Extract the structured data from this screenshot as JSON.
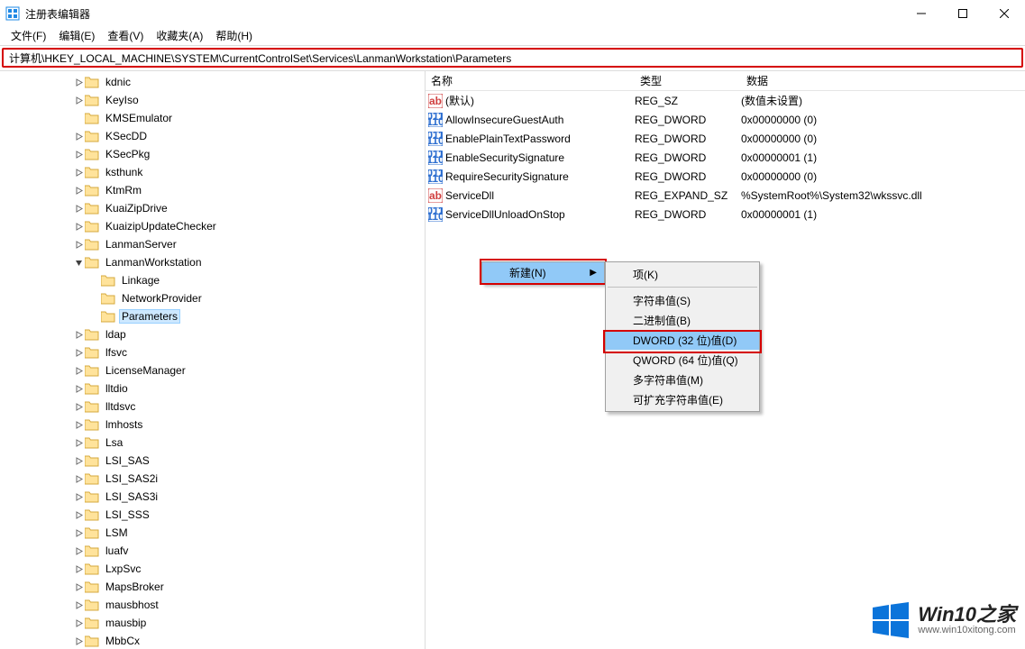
{
  "window": {
    "title": "注册表编辑器",
    "controls": {
      "min": "—",
      "max": "▢",
      "close": "✕"
    }
  },
  "menubar": [
    "文件(F)",
    "编辑(E)",
    "查看(V)",
    "收藏夹(A)",
    "帮助(H)"
  ],
  "addressbar": "计算机\\HKEY_LOCAL_MACHINE\\SYSTEM\\CurrentControlSet\\Services\\LanmanWorkstation\\Parameters",
  "tree": {
    "items": [
      {
        "level": 1,
        "expand": "closed",
        "label": "kdnic"
      },
      {
        "level": 1,
        "expand": "closed",
        "label": "KeyIso"
      },
      {
        "level": 1,
        "expand": "none",
        "label": "KMSEmulator"
      },
      {
        "level": 1,
        "expand": "closed",
        "label": "KSecDD"
      },
      {
        "level": 1,
        "expand": "closed",
        "label": "KSecPkg"
      },
      {
        "level": 1,
        "expand": "closed",
        "label": "ksthunk"
      },
      {
        "level": 1,
        "expand": "closed",
        "label": "KtmRm"
      },
      {
        "level": 1,
        "expand": "closed",
        "label": "KuaiZipDrive"
      },
      {
        "level": 1,
        "expand": "closed",
        "label": "KuaizipUpdateChecker"
      },
      {
        "level": 1,
        "expand": "closed",
        "label": "LanmanServer"
      },
      {
        "level": 1,
        "expand": "open",
        "label": "LanmanWorkstation"
      },
      {
        "level": 2,
        "expand": "none",
        "label": "Linkage"
      },
      {
        "level": 2,
        "expand": "none",
        "label": "NetworkProvider"
      },
      {
        "level": 2,
        "expand": "none",
        "label": "Parameters",
        "selected": true
      },
      {
        "level": 1,
        "expand": "closed",
        "label": "ldap"
      },
      {
        "level": 1,
        "expand": "closed",
        "label": "lfsvc"
      },
      {
        "level": 1,
        "expand": "closed",
        "label": "LicenseManager"
      },
      {
        "level": 1,
        "expand": "closed",
        "label": "lltdio"
      },
      {
        "level": 1,
        "expand": "closed",
        "label": "lltdsvc"
      },
      {
        "level": 1,
        "expand": "closed",
        "label": "lmhosts"
      },
      {
        "level": 1,
        "expand": "closed",
        "label": "Lsa"
      },
      {
        "level": 1,
        "expand": "closed",
        "label": "LSI_SAS"
      },
      {
        "level": 1,
        "expand": "closed",
        "label": "LSI_SAS2i"
      },
      {
        "level": 1,
        "expand": "closed",
        "label": "LSI_SAS3i"
      },
      {
        "level": 1,
        "expand": "closed",
        "label": "LSI_SSS"
      },
      {
        "level": 1,
        "expand": "closed",
        "label": "LSM"
      },
      {
        "level": 1,
        "expand": "closed",
        "label": "luafv"
      },
      {
        "level": 1,
        "expand": "closed",
        "label": "LxpSvc"
      },
      {
        "level": 1,
        "expand": "closed",
        "label": "MapsBroker"
      },
      {
        "level": 1,
        "expand": "closed",
        "label": "mausbhost"
      },
      {
        "level": 1,
        "expand": "closed",
        "label": "mausbip"
      },
      {
        "level": 1,
        "expand": "closed",
        "label": "MbbCx"
      }
    ]
  },
  "list": {
    "columns": {
      "name": "名称",
      "type": "类型",
      "data": "数据"
    },
    "rows": [
      {
        "icon": "str",
        "name": "(默认)",
        "type": "REG_SZ",
        "data": "(数值未设置)"
      },
      {
        "icon": "bin",
        "name": "AllowInsecureGuestAuth",
        "type": "REG_DWORD",
        "data": "0x00000000 (0)"
      },
      {
        "icon": "bin",
        "name": "EnablePlainTextPassword",
        "type": "REG_DWORD",
        "data": "0x00000000 (0)"
      },
      {
        "icon": "bin",
        "name": "EnableSecuritySignature",
        "type": "REG_DWORD",
        "data": "0x00000001 (1)"
      },
      {
        "icon": "bin",
        "name": "RequireSecuritySignature",
        "type": "REG_DWORD",
        "data": "0x00000000 (0)"
      },
      {
        "icon": "str",
        "name": "ServiceDll",
        "type": "REG_EXPAND_SZ",
        "data": "%SystemRoot%\\System32\\wkssvc.dll"
      },
      {
        "icon": "bin",
        "name": "ServiceDllUnloadOnStop",
        "type": "REG_DWORD",
        "data": "0x00000001 (1)"
      }
    ]
  },
  "context_menu": {
    "primary": {
      "label": "新建(N)"
    },
    "sub": [
      {
        "label": "项(K)",
        "sep_after": true
      },
      {
        "label": "字符串值(S)"
      },
      {
        "label": "二进制值(B)"
      },
      {
        "label": "DWORD (32 位)值(D)",
        "highlight": true
      },
      {
        "label": "QWORD (64 位)值(Q)"
      },
      {
        "label": "多字符串值(M)"
      },
      {
        "label": "可扩充字符串值(E)"
      }
    ]
  },
  "watermark": {
    "line1": "Win10之家",
    "line2": "www.win10xitong.com"
  }
}
